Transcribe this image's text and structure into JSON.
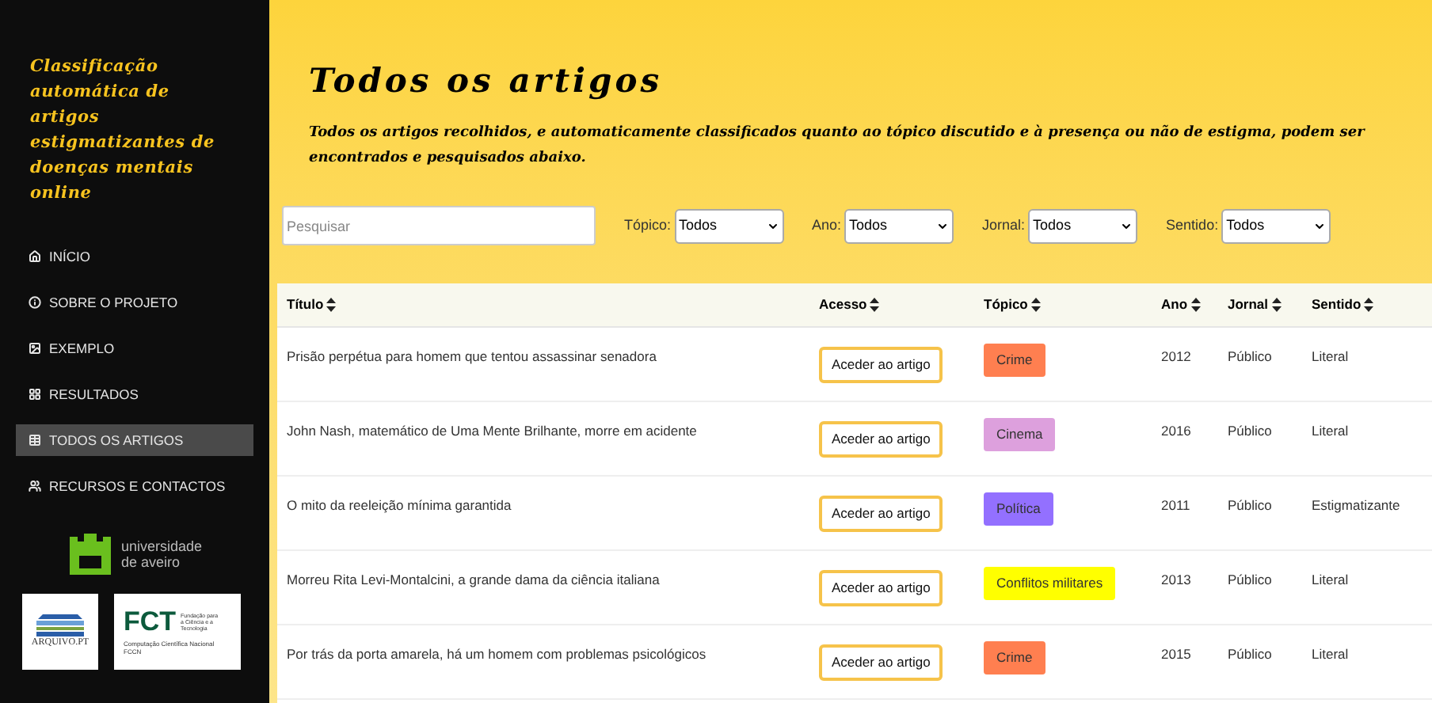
{
  "sidebar": {
    "title": "Classificação automática de artigos estigmatizantes de doenças mentais online",
    "items": [
      {
        "label": "INÍCIO",
        "selected": false
      },
      {
        "label": "SOBRE O PROJETO",
        "selected": false
      },
      {
        "label": "EXEMPLO",
        "selected": false
      },
      {
        "label": "RESULTADOS",
        "selected": false
      },
      {
        "label": "TODOS OS ARTIGOS",
        "selected": true
      },
      {
        "label": "RECURSOS E CONTACTOS",
        "selected": false
      }
    ],
    "logos": {
      "university": [
        "universidade",
        "de aveiro"
      ],
      "arquivo": "ARQUIVO.PT",
      "fct": {
        "acronym": "FCT",
        "name": "Fundação para a Ciência e a Tecnologia",
        "unit": "Computação Científica Nacional",
        "unit_short": "FCCN"
      }
    }
  },
  "page": {
    "title": "Todos os artigos",
    "description": "Todos os artigos recolhidos, e automaticamente classificados quanto ao tópico discutido e à presença ou não de estigma, podem ser encontrados e pesquisados abaixo."
  },
  "filters": {
    "search": {
      "placeholder": "Pesquisar"
    },
    "selects": [
      {
        "label": "Tópico:",
        "value": "Todos"
      },
      {
        "label": "Ano:",
        "value": "Todos"
      },
      {
        "label": "Jornal:",
        "value": "Todos"
      },
      {
        "label": "Sentido:",
        "value": "Todos"
      }
    ]
  },
  "table": {
    "columns": [
      "Título",
      "Acesso",
      "Tópico",
      "Ano",
      "Jornal",
      "Sentido"
    ],
    "rows": [
      {
        "title": "Prisão perpétua para homem que tentou assassinar senadora",
        "access": "Aceder ao artigo",
        "topic": "Crime",
        "color": "#ff7f50",
        "year": "2012",
        "journal": "Público",
        "sense": "Literal"
      },
      {
        "title": "John Nash, matemático de Uma Mente Brilhante, morre em acidente",
        "access": "Aceder ao artigo",
        "topic": "Cinema",
        "color": "#dda0dd",
        "year": "2016",
        "journal": "Público",
        "sense": "Literal"
      },
      {
        "title": "O mito da reeleição mínima garantida",
        "access": "Aceder ao artigo",
        "topic": "Política",
        "color": "#9370ff",
        "year": "2011",
        "journal": "Público",
        "sense": "Estigmatizante"
      },
      {
        "title": "Morreu Rita Levi-Montalcini, a grande dama da ciência italiana",
        "access": "Aceder ao artigo",
        "topic": "Conflitos militares",
        "color": "#ffff00",
        "year": "2013",
        "journal": "Público",
        "sense": "Literal"
      },
      {
        "title": "Por trás da porta amarela, há um homem com problemas psicológicos",
        "access": "Aceder ao artigo",
        "topic": "Crime",
        "color": "#ff7f50",
        "year": "2015",
        "journal": "Público",
        "sense": "Literal"
      }
    ]
  }
}
